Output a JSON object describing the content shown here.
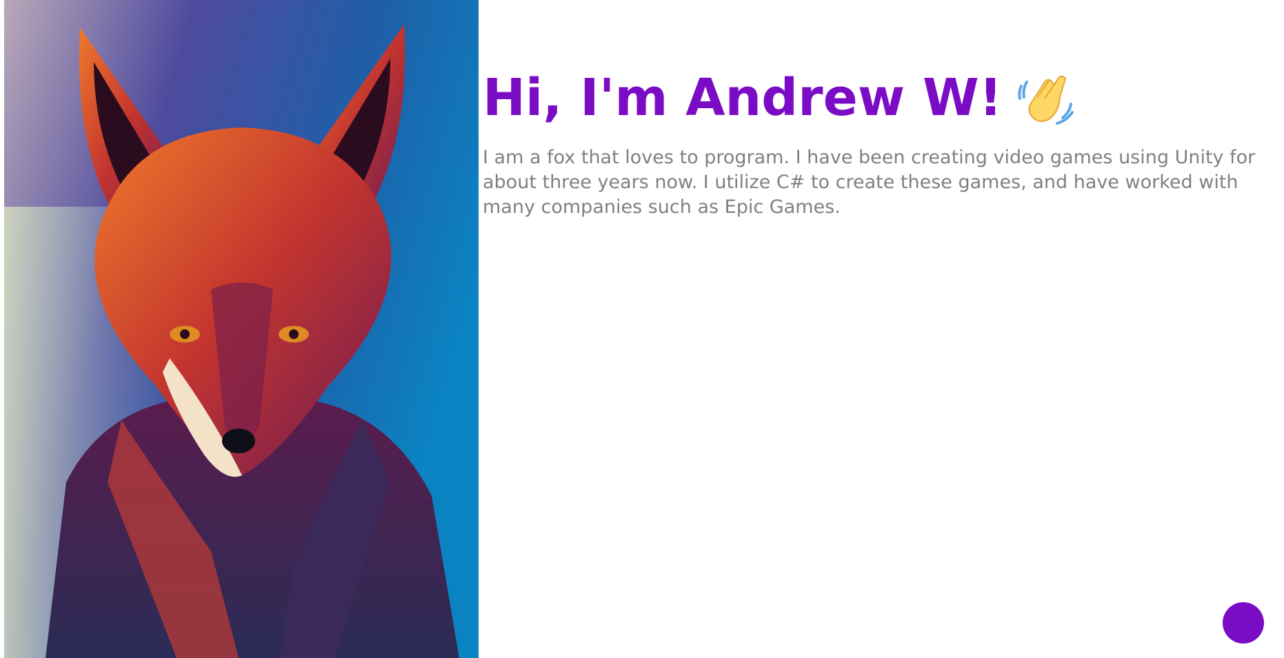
{
  "profile": {
    "heading": "Hi, I'm Andrew W!",
    "greeting_icon": "waving-hand-icon",
    "bio": "I am a fox that loves to program. I have been creating video games using Unity for about three years now. I utilize C# to create these games, and have worked with many companies such as Epic Games."
  },
  "portrait": {
    "subject": "fox-portrait-illustration"
  },
  "floating_button": {
    "icon": "circle-button"
  },
  "colors": {
    "accent": "#7b0cc6",
    "body_text": "#808080",
    "background": "#ffffff"
  }
}
